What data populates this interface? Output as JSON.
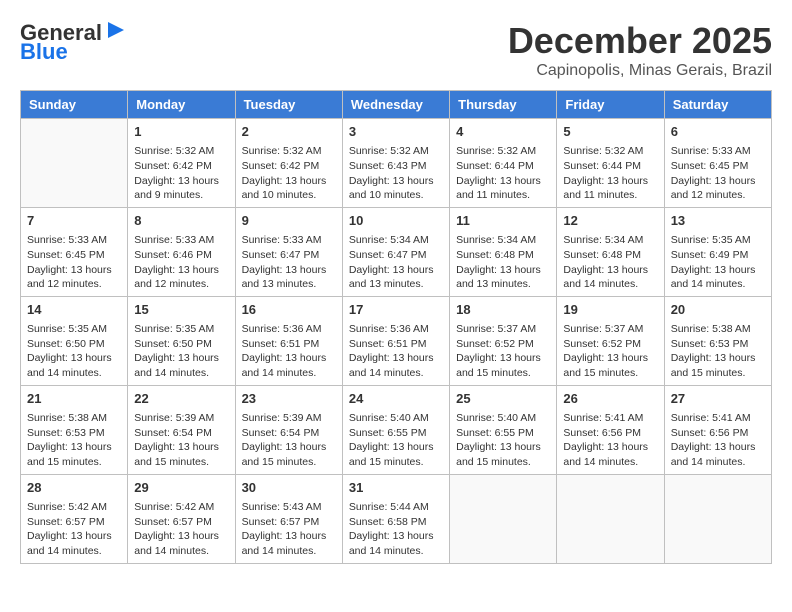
{
  "header": {
    "logo_general": "General",
    "logo_blue": "Blue",
    "month": "December 2025",
    "location": "Capinopolis, Minas Gerais, Brazil"
  },
  "weekdays": [
    "Sunday",
    "Monday",
    "Tuesday",
    "Wednesday",
    "Thursday",
    "Friday",
    "Saturday"
  ],
  "weeks": [
    [
      {
        "day": "",
        "sunrise": "",
        "sunset": "",
        "daylight": ""
      },
      {
        "day": "1",
        "sunrise": "Sunrise: 5:32 AM",
        "sunset": "Sunset: 6:42 PM",
        "daylight": "Daylight: 13 hours and 9 minutes."
      },
      {
        "day": "2",
        "sunrise": "Sunrise: 5:32 AM",
        "sunset": "Sunset: 6:42 PM",
        "daylight": "Daylight: 13 hours and 10 minutes."
      },
      {
        "day": "3",
        "sunrise": "Sunrise: 5:32 AM",
        "sunset": "Sunset: 6:43 PM",
        "daylight": "Daylight: 13 hours and 10 minutes."
      },
      {
        "day": "4",
        "sunrise": "Sunrise: 5:32 AM",
        "sunset": "Sunset: 6:44 PM",
        "daylight": "Daylight: 13 hours and 11 minutes."
      },
      {
        "day": "5",
        "sunrise": "Sunrise: 5:32 AM",
        "sunset": "Sunset: 6:44 PM",
        "daylight": "Daylight: 13 hours and 11 minutes."
      },
      {
        "day": "6",
        "sunrise": "Sunrise: 5:33 AM",
        "sunset": "Sunset: 6:45 PM",
        "daylight": "Daylight: 13 hours and 12 minutes."
      }
    ],
    [
      {
        "day": "7",
        "sunrise": "Sunrise: 5:33 AM",
        "sunset": "Sunset: 6:45 PM",
        "daylight": "Daylight: 13 hours and 12 minutes."
      },
      {
        "day": "8",
        "sunrise": "Sunrise: 5:33 AM",
        "sunset": "Sunset: 6:46 PM",
        "daylight": "Daylight: 13 hours and 12 minutes."
      },
      {
        "day": "9",
        "sunrise": "Sunrise: 5:33 AM",
        "sunset": "Sunset: 6:47 PM",
        "daylight": "Daylight: 13 hours and 13 minutes."
      },
      {
        "day": "10",
        "sunrise": "Sunrise: 5:34 AM",
        "sunset": "Sunset: 6:47 PM",
        "daylight": "Daylight: 13 hours and 13 minutes."
      },
      {
        "day": "11",
        "sunrise": "Sunrise: 5:34 AM",
        "sunset": "Sunset: 6:48 PM",
        "daylight": "Daylight: 13 hours and 13 minutes."
      },
      {
        "day": "12",
        "sunrise": "Sunrise: 5:34 AM",
        "sunset": "Sunset: 6:48 PM",
        "daylight": "Daylight: 13 hours and 14 minutes."
      },
      {
        "day": "13",
        "sunrise": "Sunrise: 5:35 AM",
        "sunset": "Sunset: 6:49 PM",
        "daylight": "Daylight: 13 hours and 14 minutes."
      }
    ],
    [
      {
        "day": "14",
        "sunrise": "Sunrise: 5:35 AM",
        "sunset": "Sunset: 6:50 PM",
        "daylight": "Daylight: 13 hours and 14 minutes."
      },
      {
        "day": "15",
        "sunrise": "Sunrise: 5:35 AM",
        "sunset": "Sunset: 6:50 PM",
        "daylight": "Daylight: 13 hours and 14 minutes."
      },
      {
        "day": "16",
        "sunrise": "Sunrise: 5:36 AM",
        "sunset": "Sunset: 6:51 PM",
        "daylight": "Daylight: 13 hours and 14 minutes."
      },
      {
        "day": "17",
        "sunrise": "Sunrise: 5:36 AM",
        "sunset": "Sunset: 6:51 PM",
        "daylight": "Daylight: 13 hours and 14 minutes."
      },
      {
        "day": "18",
        "sunrise": "Sunrise: 5:37 AM",
        "sunset": "Sunset: 6:52 PM",
        "daylight": "Daylight: 13 hours and 15 minutes."
      },
      {
        "day": "19",
        "sunrise": "Sunrise: 5:37 AM",
        "sunset": "Sunset: 6:52 PM",
        "daylight": "Daylight: 13 hours and 15 minutes."
      },
      {
        "day": "20",
        "sunrise": "Sunrise: 5:38 AM",
        "sunset": "Sunset: 6:53 PM",
        "daylight": "Daylight: 13 hours and 15 minutes."
      }
    ],
    [
      {
        "day": "21",
        "sunrise": "Sunrise: 5:38 AM",
        "sunset": "Sunset: 6:53 PM",
        "daylight": "Daylight: 13 hours and 15 minutes."
      },
      {
        "day": "22",
        "sunrise": "Sunrise: 5:39 AM",
        "sunset": "Sunset: 6:54 PM",
        "daylight": "Daylight: 13 hours and 15 minutes."
      },
      {
        "day": "23",
        "sunrise": "Sunrise: 5:39 AM",
        "sunset": "Sunset: 6:54 PM",
        "daylight": "Daylight: 13 hours and 15 minutes."
      },
      {
        "day": "24",
        "sunrise": "Sunrise: 5:40 AM",
        "sunset": "Sunset: 6:55 PM",
        "daylight": "Daylight: 13 hours and 15 minutes."
      },
      {
        "day": "25",
        "sunrise": "Sunrise: 5:40 AM",
        "sunset": "Sunset: 6:55 PM",
        "daylight": "Daylight: 13 hours and 15 minutes."
      },
      {
        "day": "26",
        "sunrise": "Sunrise: 5:41 AM",
        "sunset": "Sunset: 6:56 PM",
        "daylight": "Daylight: 13 hours and 14 minutes."
      },
      {
        "day": "27",
        "sunrise": "Sunrise: 5:41 AM",
        "sunset": "Sunset: 6:56 PM",
        "daylight": "Daylight: 13 hours and 14 minutes."
      }
    ],
    [
      {
        "day": "28",
        "sunrise": "Sunrise: 5:42 AM",
        "sunset": "Sunset: 6:57 PM",
        "daylight": "Daylight: 13 hours and 14 minutes."
      },
      {
        "day": "29",
        "sunrise": "Sunrise: 5:42 AM",
        "sunset": "Sunset: 6:57 PM",
        "daylight": "Daylight: 13 hours and 14 minutes."
      },
      {
        "day": "30",
        "sunrise": "Sunrise: 5:43 AM",
        "sunset": "Sunset: 6:57 PM",
        "daylight": "Daylight: 13 hours and 14 minutes."
      },
      {
        "day": "31",
        "sunrise": "Sunrise: 5:44 AM",
        "sunset": "Sunset: 6:58 PM",
        "daylight": "Daylight: 13 hours and 14 minutes."
      },
      {
        "day": "",
        "sunrise": "",
        "sunset": "",
        "daylight": ""
      },
      {
        "day": "",
        "sunrise": "",
        "sunset": "",
        "daylight": ""
      },
      {
        "day": "",
        "sunrise": "",
        "sunset": "",
        "daylight": ""
      }
    ]
  ]
}
